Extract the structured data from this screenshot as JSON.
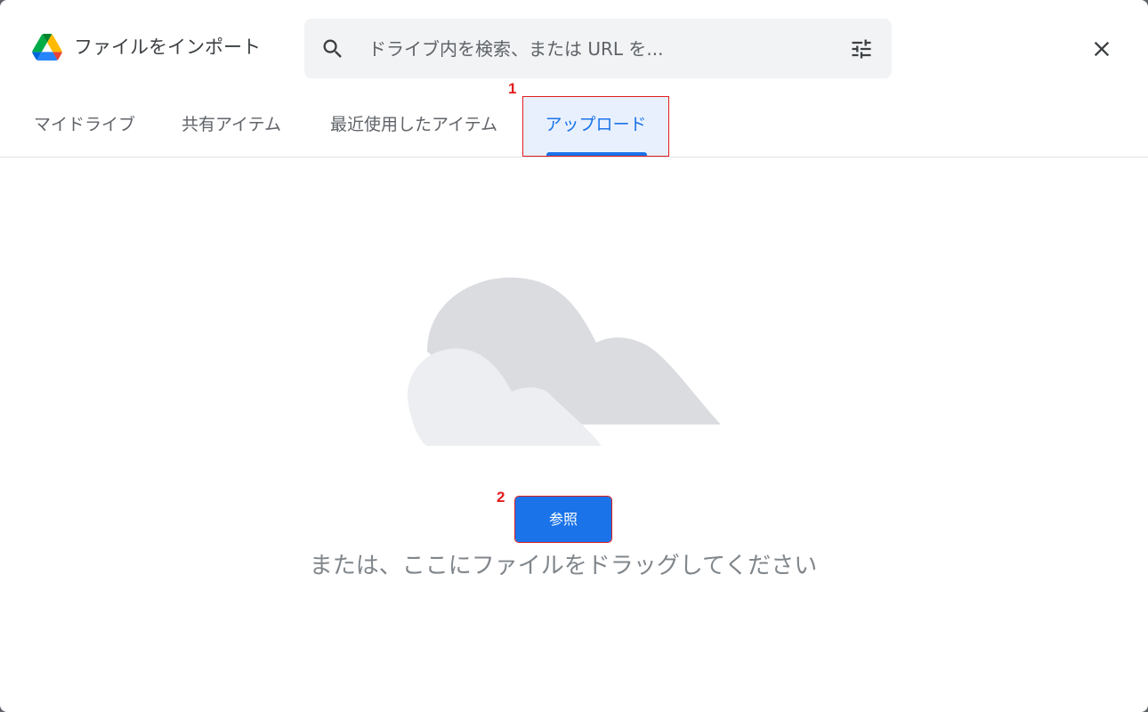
{
  "dialog": {
    "title": "ファイルをインポート",
    "logo_icon": "google-drive-logo",
    "close_icon": "close-icon"
  },
  "search": {
    "placeholder": "ドライブ内を検索、または URL を...",
    "icon": "search-icon",
    "filter_icon": "tune-icon"
  },
  "tabs": [
    {
      "label": "マイドライブ",
      "selected": false
    },
    {
      "label": "共有アイテム",
      "selected": false
    },
    {
      "label": "最近使用したアイテム",
      "selected": false
    },
    {
      "label": "アップロード",
      "selected": true
    }
  ],
  "annotations": {
    "marker_1": "1",
    "marker_2": "2",
    "color": "#e11d1d"
  },
  "upload": {
    "browse_label": "参照",
    "drag_text": "または、ここにファイルをドラッグしてください",
    "illustration": "cloud-illustration"
  },
  "colors": {
    "accent": "#1a73e8",
    "selected_tab_bg": "#e8f0fe"
  }
}
